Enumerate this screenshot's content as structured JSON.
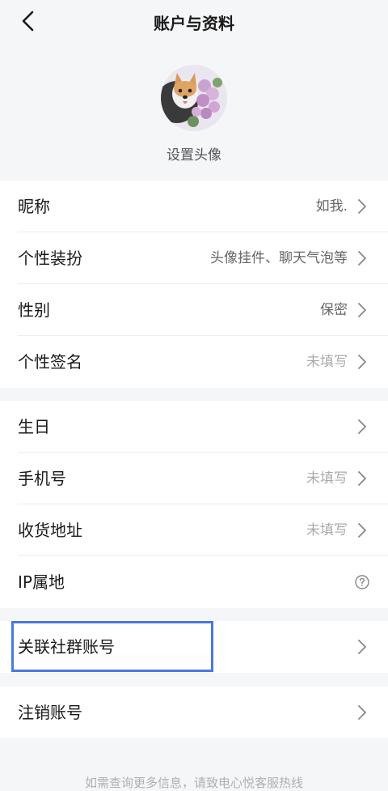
{
  "header": {
    "title": "账户与资料"
  },
  "avatar": {
    "caption": "设置头像"
  },
  "group1": [
    {
      "label": "昵称",
      "value": "如我."
    },
    {
      "label": "个性装扮",
      "value": "头像挂件、聊天气泡等"
    },
    {
      "label": "性别",
      "value": "保密"
    },
    {
      "label": "个性签名",
      "value": "未填写"
    }
  ],
  "group2": [
    {
      "label": "生日",
      "value": ""
    },
    {
      "label": "手机号",
      "value": "未填写"
    },
    {
      "label": "收货地址",
      "value": "未填写"
    },
    {
      "label": "IP属地",
      "value": ""
    }
  ],
  "group3": [
    {
      "label": "关联社群账号"
    }
  ],
  "group4": [
    {
      "label": "注销账号"
    }
  ],
  "footer": {
    "text": "如需查询更多信息，请致电心悦客服热线"
  },
  "colors": {
    "highlight": "#4a78dc",
    "background": "#f5f6f8"
  }
}
